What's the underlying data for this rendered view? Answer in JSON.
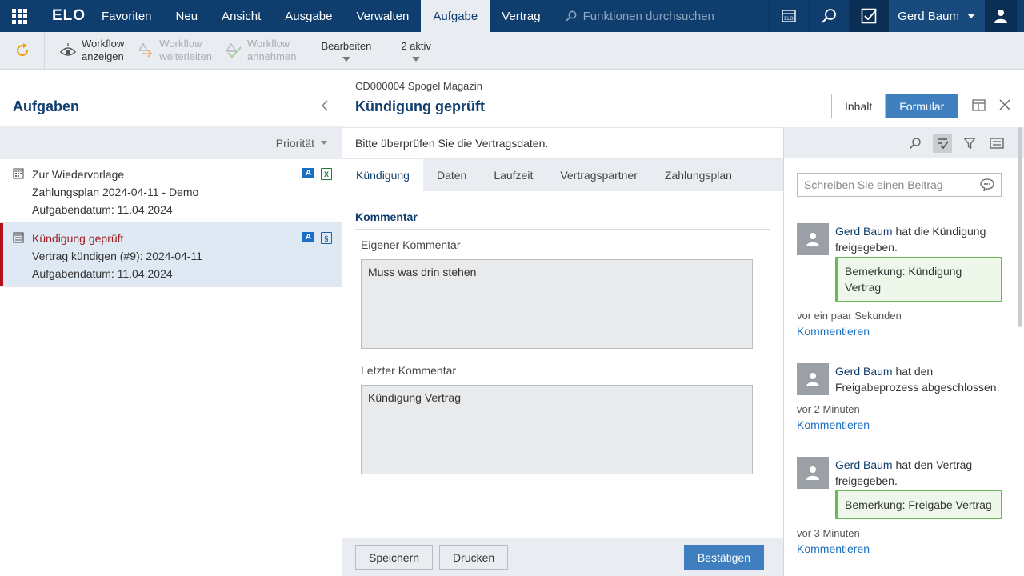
{
  "topbar": {
    "logo": "ELO",
    "menu": [
      "Favoriten",
      "Neu",
      "Ansicht",
      "Ausgabe",
      "Verwalten",
      "Aufgabe",
      "Vertrag"
    ],
    "active_menu": "Aufgabe",
    "search_placeholder": "Funktionen durchsuchen",
    "user": "Gerd Baum"
  },
  "ribbon": {
    "show_workflow": [
      "Workflow",
      "anzeigen"
    ],
    "forward_workflow": [
      "Workflow",
      "weiterleiten"
    ],
    "accept_workflow": [
      "Workflow",
      "annehmen"
    ],
    "edit": "Bearbeiten",
    "active": "2 aktiv"
  },
  "left": {
    "title": "Aufgaben",
    "sort_label": "Priorität",
    "tasks": [
      {
        "title": "Zur Wiedervorlage",
        "line2": "Zahlungsplan 2024-04-11 - Demo",
        "line3": "Aufgabendatum: 11.04.2024",
        "badge": "A",
        "file": "X"
      },
      {
        "title": "Kündigung geprüft",
        "line2": "Vertrag kündigen (#9): 2024-04-11",
        "line3": "Aufgabendatum: 11.04.2024",
        "badge": "A",
        "file": "§"
      }
    ]
  },
  "center": {
    "path": "CD000004 Spogel Magazin",
    "title": "Kündigung geprüft",
    "view_content": "Inhalt",
    "view_form": "Formular",
    "instruction": "Bitte überprüfen Sie die Vertragsdaten.",
    "tabs": [
      "Kündigung",
      "Daten",
      "Laufzeit",
      "Vertragspartner",
      "Zahlungsplan"
    ],
    "section_title": "Kommentar",
    "own_comment_label": "Eigener Kommentar",
    "own_comment_value": "Muss was drin stehen",
    "last_comment_label": "Letzter Kommentar",
    "last_comment_value": "Kündigung Vertrag",
    "btn_save": "Speichern",
    "btn_print": "Drucken",
    "btn_confirm": "Bestätigen"
  },
  "feed": {
    "placeholder": "Schreiben Sie einen Beitrag",
    "comment_label": "Kommentieren",
    "posts": [
      {
        "who": "Gerd Baum",
        "text": "hat die Kündigung freigegeben.",
        "remark": "Bemerkung: Kündigung Vertrag",
        "time": "vor ein paar Sekunden"
      },
      {
        "who": "Gerd Baum",
        "text": "hat den Freigabeprozess abgeschlossen.",
        "remark": "",
        "time": "vor 2 Minuten"
      },
      {
        "who": "Gerd Baum",
        "text": "hat den Vertrag freigegeben.",
        "remark": "Bemerkung: Freigabe Vertrag",
        "time": "vor 3 Minuten"
      }
    ]
  },
  "colors": {
    "brand": "#0f3d6e",
    "accent": "#3f7fbf",
    "selected_marker": "#b3111a",
    "remark_green": "#6cb95a"
  }
}
